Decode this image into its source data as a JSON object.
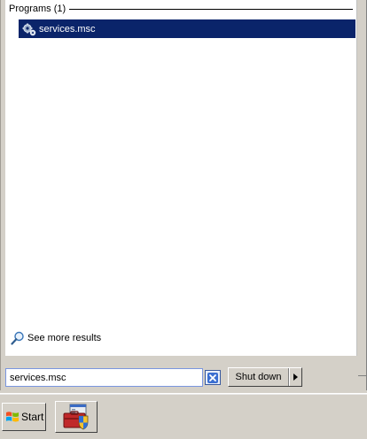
{
  "search_results": {
    "group_title": "Programs (1)",
    "items": [
      {
        "label": "services.msc",
        "icon": "services-gear-icon",
        "selected": true
      }
    ],
    "see_more_label": "See more results"
  },
  "search_box": {
    "value": "services.msc",
    "clear_icon": "clear-x-icon"
  },
  "power": {
    "shutdown_label": "Shut down",
    "options_icon": "triangle-right-icon"
  },
  "taskbar": {
    "start_label": "Start",
    "pinned": [
      {
        "icon": "server-manager-icon"
      }
    ]
  },
  "colors": {
    "selection": "#0a246a",
    "face": "#d4d0c8",
    "input_border": "#7a96df"
  }
}
